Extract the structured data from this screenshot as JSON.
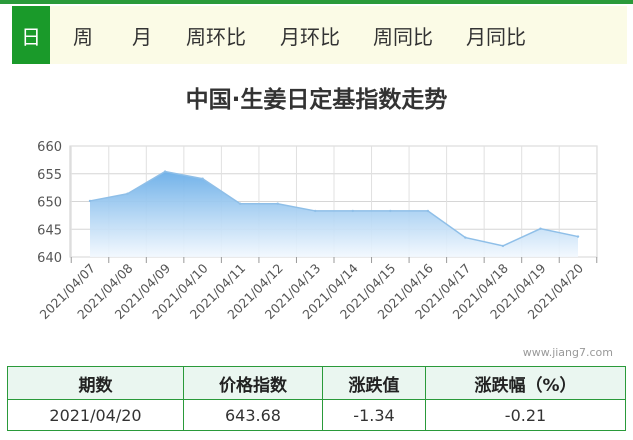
{
  "tabs": [
    {
      "label": "日",
      "active": true
    },
    {
      "label": "周",
      "active": false
    },
    {
      "label": "月",
      "active": false
    },
    {
      "label": "周环比",
      "active": false
    },
    {
      "label": "月环比",
      "active": false
    },
    {
      "label": "周同比",
      "active": false
    },
    {
      "label": "月同比",
      "active": false
    }
  ],
  "watermark": "www.jiang7.com",
  "chart_data": {
    "type": "area",
    "title": "中国·生姜日定基指数走势",
    "categories": [
      "2021/04/07",
      "2021/04/08",
      "2021/04/09",
      "2021/04/10",
      "2021/04/11",
      "2021/04/12",
      "2021/04/13",
      "2021/04/14",
      "2021/04/15",
      "2021/04/16",
      "2021/04/17",
      "2021/04/18",
      "2021/04/19",
      "2021/04/20"
    ],
    "series": [
      {
        "values": [
          650.1,
          651.4,
          655.4,
          654.1,
          649.6,
          649.6,
          648.3,
          648.3,
          648.3,
          648.3,
          643.5,
          642.0,
          645.1,
          643.68
        ]
      }
    ],
    "ylim": [
      640,
      660
    ],
    "yticks": [
      640,
      645,
      650,
      655,
      660
    ],
    "grid": true,
    "colors": {
      "line": "#8fbfe8",
      "fill_top": "#6aaee8",
      "fill_bottom": "#f2f8fe"
    }
  },
  "summary": {
    "headers": [
      "期数",
      "价格指数",
      "涨跌值",
      "涨跌幅（%）"
    ],
    "row": [
      "2021/04/20",
      "643.68",
      "-1.34",
      "-0.21"
    ]
  }
}
